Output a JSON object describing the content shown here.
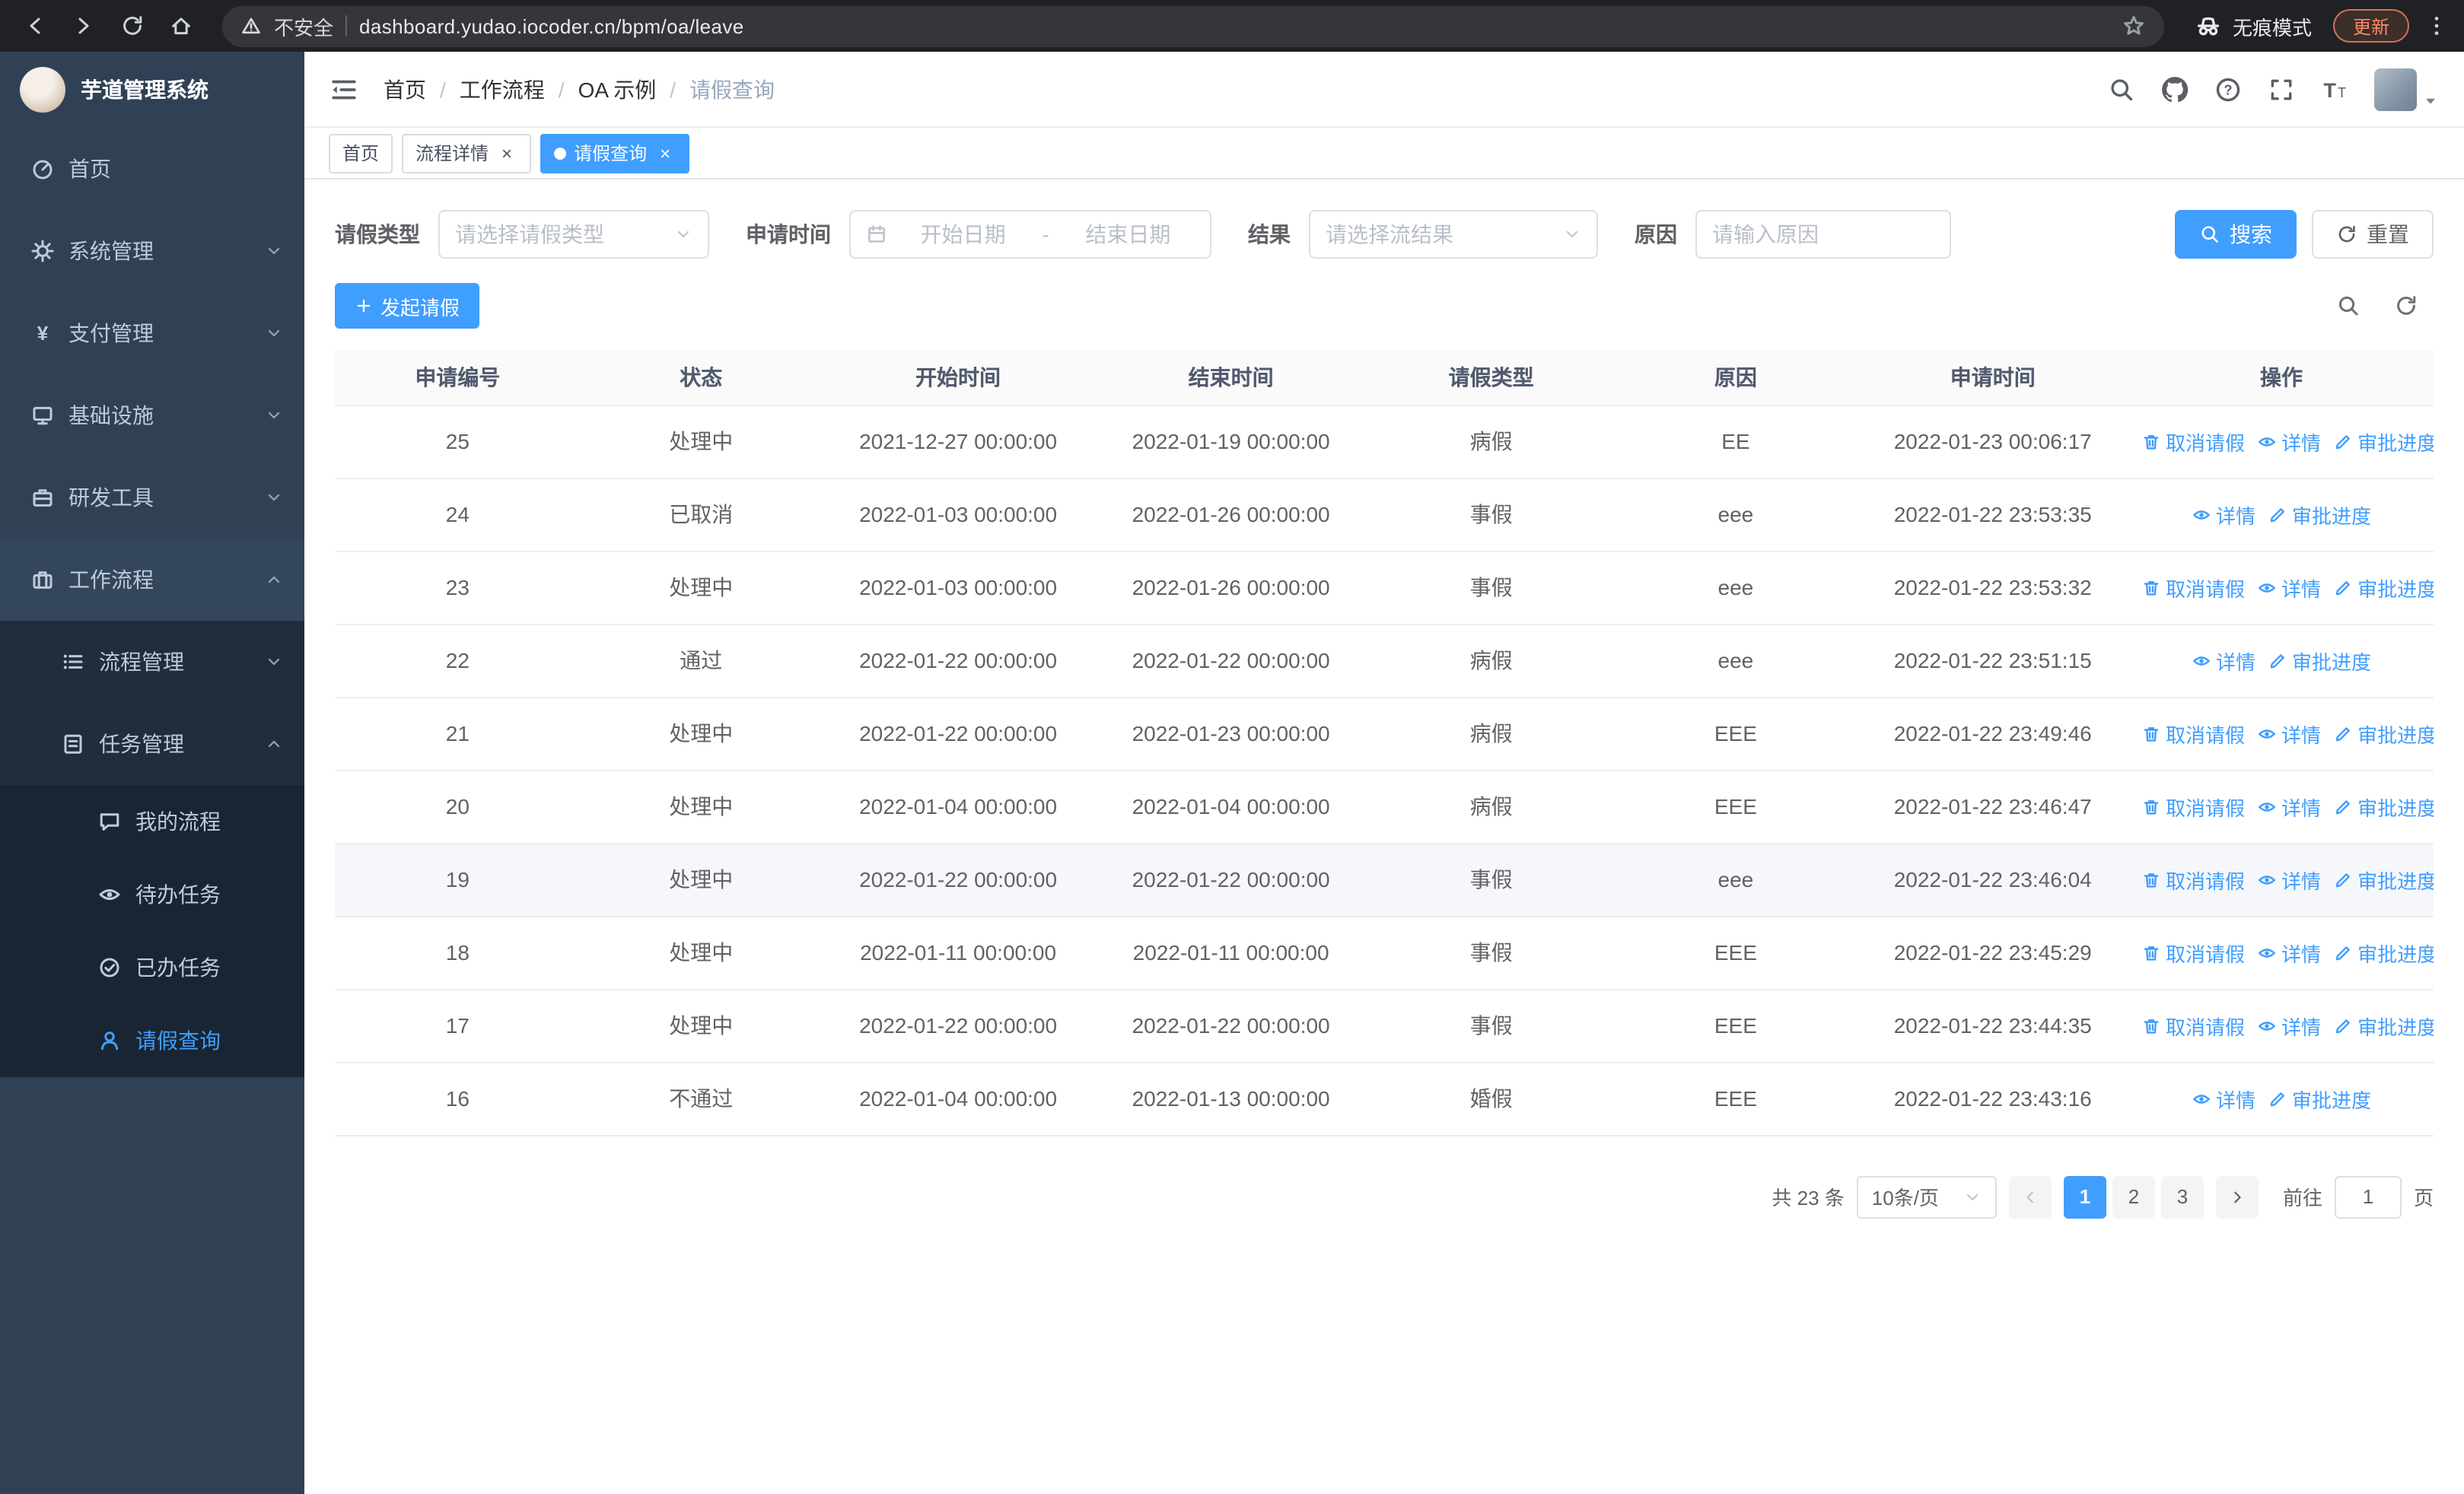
{
  "browser": {
    "url": "dashboard.yudao.iocoder.cn/bpm/oa/leave",
    "security_label": "不安全",
    "incognito_label": "无痕模式",
    "update_label": "更新",
    "nav_icons": [
      "back-icon",
      "forward-icon",
      "reload-icon",
      "home-icon"
    ]
  },
  "sidebar": {
    "logo_title": "芋道管理系统",
    "items": [
      {
        "key": "home",
        "label": "首页",
        "icon": "dashboard-icon",
        "level": 1
      },
      {
        "key": "system-management",
        "label": "系统管理",
        "icon": "gear-icon",
        "level": 1,
        "chevron": "down"
      },
      {
        "key": "payment-management",
        "label": "支付管理",
        "icon": "yen-icon",
        "level": 1,
        "chevron": "down"
      },
      {
        "key": "infrastructure",
        "label": "基础设施",
        "icon": "monitor-icon",
        "level": 1,
        "chevron": "down"
      },
      {
        "key": "dev-tools",
        "label": "研发工具",
        "icon": "briefcase-icon",
        "level": 1,
        "chevron": "down"
      },
      {
        "key": "workflow",
        "label": "工作流程",
        "icon": "suitcase-icon",
        "level": 1,
        "chevron": "up",
        "active_trail": true
      },
      {
        "key": "process-management",
        "label": "流程管理",
        "icon": "list-icon",
        "level": 2,
        "chevron": "down"
      },
      {
        "key": "task-management",
        "label": "任务管理",
        "icon": "tasks-icon",
        "level": 2,
        "chevron": "up"
      },
      {
        "key": "my-processes",
        "label": "我的流程",
        "icon": "chat-icon",
        "level": 3
      },
      {
        "key": "todo-tasks",
        "label": "待办任务",
        "icon": "eye-icon",
        "level": 3
      },
      {
        "key": "done-tasks",
        "label": "已办任务",
        "icon": "done-icon",
        "level": 3
      },
      {
        "key": "leave-query",
        "label": "请假查询",
        "icon": "user-icon",
        "level": 3,
        "active": true
      }
    ]
  },
  "header": {
    "breadcrumb": [
      "首页",
      "工作流程",
      "OA 示例",
      "请假查询"
    ],
    "right_icons": [
      "search-icon",
      "github-icon",
      "help-icon",
      "fullscreen-icon",
      "fontsize-icon"
    ]
  },
  "tags": [
    {
      "key": "home",
      "label": "首页",
      "closable": false,
      "active": false
    },
    {
      "key": "process-detail",
      "label": "流程详情",
      "closable": true,
      "active": false
    },
    {
      "key": "leave-query",
      "label": "请假查询",
      "closable": true,
      "active": true
    }
  ],
  "filters": {
    "leave_type_label": "请假类型",
    "leave_type_placeholder": "请选择请假类型",
    "apply_time_label": "申请时间",
    "start_date_placeholder": "开始日期",
    "date_separator": "-",
    "end_date_placeholder": "结束日期",
    "result_label": "结果",
    "result_placeholder": "请选择流结果",
    "reason_label": "原因",
    "reason_placeholder": "请输入原因",
    "search_label": "搜索",
    "reset_label": "重置"
  },
  "toolbar": {
    "create_label": "发起请假"
  },
  "table": {
    "columns": [
      "申请编号",
      "状态",
      "开始时间",
      "结束时间",
      "请假类型",
      "原因",
      "申请时间",
      "操作"
    ],
    "actions": {
      "cancel": {
        "label": "取消请假",
        "icon": "trash-icon"
      },
      "detail": {
        "label": "详情",
        "icon": "eye-icon"
      },
      "progress": {
        "label": "审批进度",
        "icon": "edit-icon"
      }
    },
    "rows": [
      {
        "id": "25",
        "status": "处理中",
        "start": "2021-12-27 00:00:00",
        "end": "2022-01-19 00:00:00",
        "type": "病假",
        "reason": "EE",
        "applied": "2022-01-23 00:06:17",
        "actions": [
          "cancel",
          "detail",
          "progress"
        ]
      },
      {
        "id": "24",
        "status": "已取消",
        "start": "2022-01-03 00:00:00",
        "end": "2022-01-26 00:00:00",
        "type": "事假",
        "reason": "eee",
        "applied": "2022-01-22 23:53:35",
        "actions": [
          "detail",
          "progress"
        ]
      },
      {
        "id": "23",
        "status": "处理中",
        "start": "2022-01-03 00:00:00",
        "end": "2022-01-26 00:00:00",
        "type": "事假",
        "reason": "eee",
        "applied": "2022-01-22 23:53:32",
        "actions": [
          "cancel",
          "detail",
          "progress"
        ]
      },
      {
        "id": "22",
        "status": "通过",
        "start": "2022-01-22 00:00:00",
        "end": "2022-01-22 00:00:00",
        "type": "病假",
        "reason": "eee",
        "applied": "2022-01-22 23:51:15",
        "actions": [
          "detail",
          "progress"
        ]
      },
      {
        "id": "21",
        "status": "处理中",
        "start": "2022-01-22 00:00:00",
        "end": "2022-01-23 00:00:00",
        "type": "病假",
        "reason": "EEE",
        "applied": "2022-01-22 23:49:46",
        "actions": [
          "cancel",
          "detail",
          "progress"
        ]
      },
      {
        "id": "20",
        "status": "处理中",
        "start": "2022-01-04 00:00:00",
        "end": "2022-01-04 00:00:00",
        "type": "病假",
        "reason": "EEE",
        "applied": "2022-01-22 23:46:47",
        "actions": [
          "cancel",
          "detail",
          "progress"
        ]
      },
      {
        "id": "19",
        "status": "处理中",
        "start": "2022-01-22 00:00:00",
        "end": "2022-01-22 00:00:00",
        "type": "事假",
        "reason": "eee",
        "applied": "2022-01-22 23:46:04",
        "actions": [
          "cancel",
          "detail",
          "progress"
        ],
        "highlight": true
      },
      {
        "id": "18",
        "status": "处理中",
        "start": "2022-01-11 00:00:00",
        "end": "2022-01-11 00:00:00",
        "type": "事假",
        "reason": "EEE",
        "applied": "2022-01-22 23:45:29",
        "actions": [
          "cancel",
          "detail",
          "progress"
        ]
      },
      {
        "id": "17",
        "status": "处理中",
        "start": "2022-01-22 00:00:00",
        "end": "2022-01-22 00:00:00",
        "type": "事假",
        "reason": "EEE",
        "applied": "2022-01-22 23:44:35",
        "actions": [
          "cancel",
          "detail",
          "progress"
        ]
      },
      {
        "id": "16",
        "status": "不通过",
        "start": "2022-01-04 00:00:00",
        "end": "2022-01-13 00:00:00",
        "type": "婚假",
        "reason": "EEE",
        "applied": "2022-01-22 23:43:16",
        "actions": [
          "detail",
          "progress"
        ]
      }
    ]
  },
  "pagination": {
    "total_text": "共 23 条",
    "page_size": "10条/页",
    "pages": [
      "1",
      "2",
      "3"
    ],
    "active_page": "1",
    "goto_label": "前往",
    "goto_value": "1",
    "goto_suffix": "页"
  },
  "colors": {
    "accent": "#409eff",
    "sidebar_bg": "#304156",
    "submenu_bg": "#1f2d3d",
    "chrome_bg": "#202124",
    "update_orange": "#ff8a65"
  }
}
